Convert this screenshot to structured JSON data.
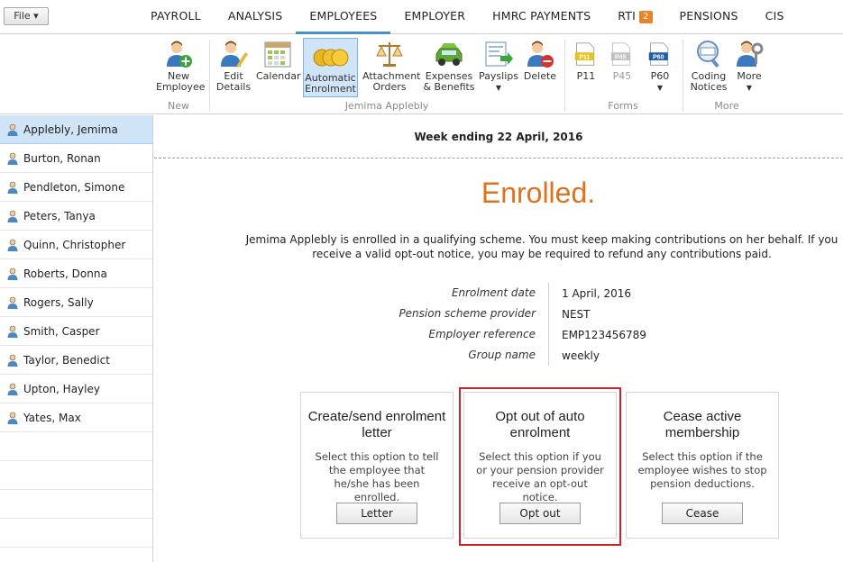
{
  "file_menu": "File ▾",
  "nav": [
    {
      "label": "PAYROLL"
    },
    {
      "label": "ANALYSIS"
    },
    {
      "label": "EMPLOYEES",
      "active": true
    },
    {
      "label": "EMPLOYER"
    },
    {
      "label": "HMRC PAYMENTS"
    },
    {
      "label": "RTI",
      "badge": "2"
    },
    {
      "label": "PENSIONS"
    },
    {
      "label": "CIS"
    }
  ],
  "ribbon": {
    "new_employee": "New Employee",
    "edit_details": "Edit Details",
    "calendar": "Calendar",
    "automatic_enrolment": "Automatic Enrolment",
    "attachment_orders": "Attachment Orders",
    "expenses_benefits": "Expenses & Benefits",
    "payslips": "Payslips",
    "delete": "Delete",
    "p11": "P11",
    "p45": "P45",
    "p60": "P60",
    "coding_notices": "Coding Notices",
    "more": "More",
    "caret": "▼",
    "group_new": "New",
    "group_employee": "Jemima Applebly",
    "group_forms": "Forms",
    "group_more": "More",
    "doc_p11": "P11",
    "doc_p45": "P45",
    "doc_p60": "P60"
  },
  "employees": [
    "Applebly, Jemima",
    "Burton, Ronan",
    "Pendleton, Simone",
    "Peters, Tanya",
    "Quinn, Christopher",
    "Roberts, Donna",
    "Rogers, Sally",
    "Smith, Casper",
    "Taylor, Benedict",
    "Upton, Hayley",
    "Yates, Max"
  ],
  "main": {
    "week": "Week ending 22 April, 2016",
    "status": "Enrolled.",
    "description": "Jemima Applebly is enrolled in a qualifying scheme. You must keep making contributions on her behalf. If you receive a valid opt-out notice, you may be required to refund any contributions paid.",
    "details": [
      {
        "key": "Enrolment date",
        "value": "1 April, 2016"
      },
      {
        "key": "Pension scheme provider",
        "value": "NEST"
      },
      {
        "key": "Employer reference",
        "value": "EMP123456789"
      },
      {
        "key": "Group name",
        "value": "weekly"
      }
    ],
    "cards": [
      {
        "title": "Create/send enrolment letter",
        "text": "Select this option to tell the employee that he/she has been enrolled.",
        "button": "Letter"
      },
      {
        "title": "Opt out of auto enrolment",
        "text": "Select this option if you or your pension provider receive an opt-out notice.",
        "button": "Opt out"
      },
      {
        "title": "Cease active membership",
        "text": "Select this option if the employee wishes to stop pension deductions.",
        "button": "Cease"
      }
    ]
  },
  "colors": {
    "accent": "#4a90c8",
    "status": "#e0721e",
    "highlight": "#d0202a",
    "selected": "#cfe4f7"
  }
}
